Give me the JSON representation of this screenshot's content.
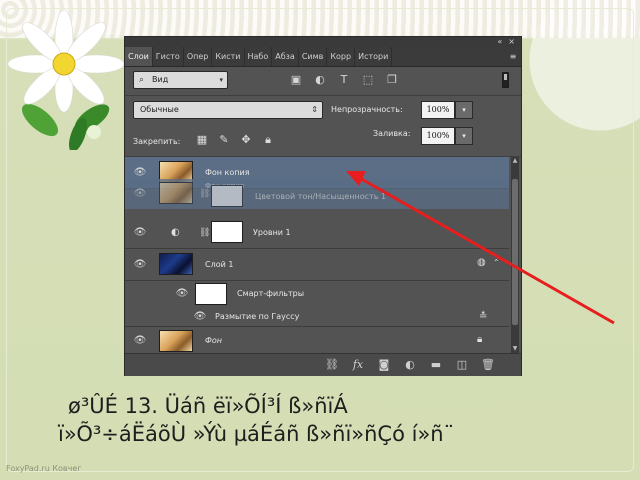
{
  "panel": {
    "tabs": [
      "Слои",
      "Гисто",
      "Опер",
      "Кисти",
      "Набо",
      "Абза",
      "Симв",
      "Корр",
      "Истори"
    ],
    "window_buttons": [
      "«",
      "×"
    ],
    "filter": {
      "selected": "Вид"
    },
    "blend_mode": {
      "selected": "Обычные"
    },
    "opacity": {
      "label": "Непрозрачность:",
      "value": "100%"
    },
    "lock": {
      "label": "Закрепить:"
    },
    "fill": {
      "label": "Заливка:",
      "value": "100%"
    },
    "layers": [
      {
        "name": "Фон копия",
        "selected": true
      },
      {
        "name": "Фон копия",
        "ghost": true
      },
      {
        "name": "Цветовой тон/Насыщенность 1",
        "ghost": true
      },
      {
        "name": "Уровни 1"
      },
      {
        "name": "Слой 1"
      },
      {
        "name": "Смарт-фильтры"
      },
      {
        "name": "Размытие по Гауссу"
      },
      {
        "name": "Фон",
        "italic": true
      }
    ]
  },
  "caption": {
    "line1": "ø³ÛÉ 13. Üáñ ëï»ÕÍ³Í ß»ñïÁ",
    "line2": "ï»Õ³÷áËáõÙ »Ýù µáÉáñ ß»ñï»ñÇó í»ñ¨"
  },
  "footer": "FoxyPad.ru Ковчег",
  "colors": {
    "arrow": "#e61e1e",
    "selected_layer": "#5b6e85",
    "panel_bg": "#535353"
  }
}
